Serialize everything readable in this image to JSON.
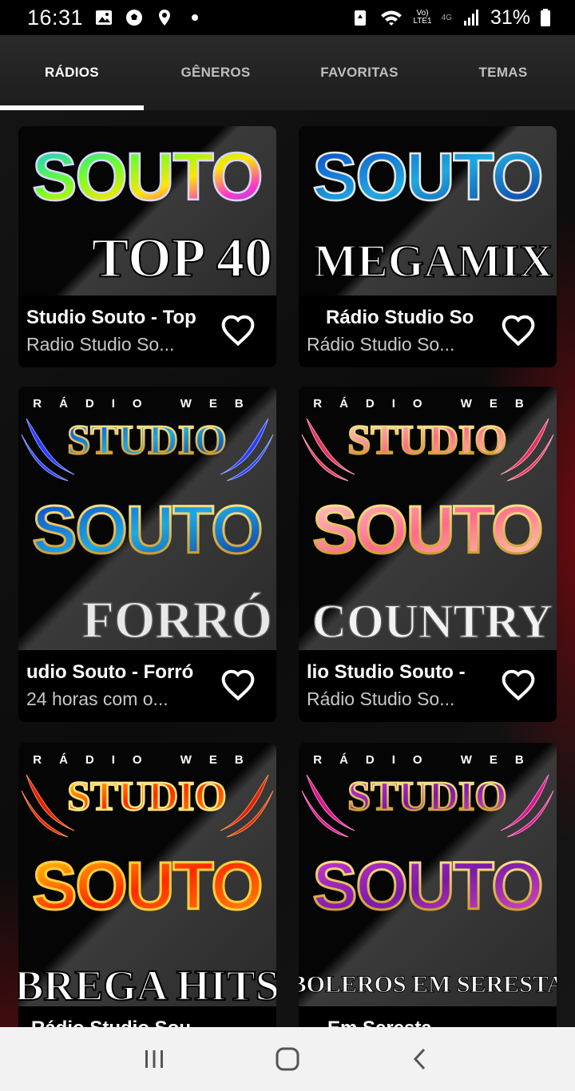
{
  "status_bar": {
    "time": "16:31",
    "battery": "31%",
    "network_top": "Vo)",
    "network_bottom": "LTE1",
    "network_gen": "4G",
    "icons": [
      "gallery-icon",
      "soccer-ball-icon",
      "location-icon",
      "dot-icon",
      "recycle-icon",
      "wifi-icon",
      "signal-icon",
      "battery-icon"
    ]
  },
  "tabs": [
    {
      "label": "RÁDIOS",
      "active": true
    },
    {
      "label": "GÊNEROS",
      "active": false
    },
    {
      "label": "FAVORITAS",
      "active": false
    },
    {
      "label": "TEMAS",
      "active": false
    }
  ],
  "stations": [
    {
      "art_top": "SOUTO",
      "art_bottom": "TOP 40",
      "title": "Studio Souto - Top",
      "subtitle": "Radio Studio So..."
    },
    {
      "art_top": "SOUTO",
      "art_bottom": "MEGAMIX",
      "title": "Rádio Studio So",
      "subtitle": "Rádio Studio So..."
    },
    {
      "art_head": "RÁDIO WEB",
      "art_top": "STUDIO",
      "art_mid": "SOUTO",
      "art_bottom": "FORRÓ",
      "title": "udio Souto - Forró",
      "subtitle": "24 horas com o..."
    },
    {
      "art_head": "RÁDIO WEB",
      "art_top": "STUDIO",
      "art_mid": "SOUTO",
      "art_bottom": "COUNTRY",
      "title": "lio Studio Souto -",
      "subtitle": "Rádio Studio So..."
    },
    {
      "art_head": "RÁDIO WEB",
      "art_top": "STUDIO",
      "art_mid": "SOUTO",
      "art_bottom": "BREGA HITS",
      "title": "Rádio Studio Sou",
      "subtitle": ""
    },
    {
      "art_head": "RÁDIO WEB",
      "art_top": "STUDIO",
      "art_mid": "SOUTO",
      "art_bottom": "BOLEROS EM SERESTA",
      "title": "Em Seresta",
      "subtitle": ""
    }
  ],
  "colors": {
    "accent": "#ffffff",
    "tab_bar": "#222222",
    "card_bg": "#000000",
    "nav_bar": "#f2f2f2"
  },
  "nav": {
    "recents": "recents-icon",
    "home": "home-icon",
    "back": "back-icon"
  }
}
